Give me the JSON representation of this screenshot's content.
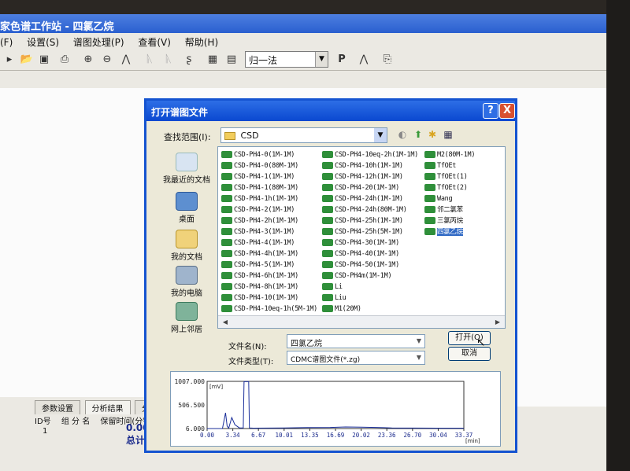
{
  "window": {
    "title": "家色谱工作站 - 四氯乙烷"
  },
  "menu": [
    {
      "label": "(F)"
    },
    {
      "label": "设置(S)"
    },
    {
      "label": "谱图处理(P)"
    },
    {
      "label": "查看(V)"
    },
    {
      "label": "帮助(H)"
    }
  ],
  "toolbar": {
    "icons": [
      "open-icon",
      "save-icon",
      "print-icon",
      "zoom-in-icon",
      "zoom-out-icon",
      "peak-icon",
      "integrate-icon",
      "report-icon",
      "table-icon"
    ],
    "method_combo": "归一法",
    "p_label": "P"
  },
  "bottom": {
    "tabs": [
      "参数设置",
      "分析结果",
      "分"
    ],
    "headers": [
      "ID号",
      "组 分 名",
      "保留时间(分钟)"
    ],
    "row_id": "1",
    "value": "0.000",
    "total_label": "总计:"
  },
  "dialog": {
    "title": "打开谱图文件",
    "help_btn": "?",
    "close_btn": "X",
    "look_in_label": "查找范围(I):",
    "look_in_value": "CSD",
    "places": [
      {
        "label": "我最近的文档",
        "icon": "recent-docs-icon"
      },
      {
        "label": "桌面",
        "icon": "desktop-icon"
      },
      {
        "label": "我的文档",
        "icon": "my-documents-icon"
      },
      {
        "label": "我的电脑",
        "icon": "my-computer-icon"
      },
      {
        "label": "网上邻居",
        "icon": "network-icon"
      }
    ],
    "files_col1": [
      "CSD-PH4-0(1M-1M)",
      "CSD-PH4-0(80M-1M)",
      "CSD-PH4-1(1M-1M)",
      "CSD-PH4-1(80M-1M)",
      "CSD-PH4-1h(1M-1M)",
      "CSD-PH4-2(1M-1M)",
      "CSD-PH4-2h(1M-1M)",
      "CSD-PH4-3(1M-1M)",
      "CSD-PH4-4(1M-1M)",
      "CSD-PH4-4h(1M-1M)",
      "CSD-PH4-5(1M-1M)",
      "CSD-PH4-6h(1M-1M)",
      "CSD-PH4-8h(1M-1M)",
      "CSD-PH4-10(1M-1M)",
      "CSD-PH4-10eq-1h(5M-1M)"
    ],
    "files_col2": [
      "CSD-PH4-10eq-2h(1M-1M)",
      "CSD-PH4-10h(1M-1M)",
      "CSD-PH4-12h(1M-1M)",
      "CSD-PH4-20(1M-1M)",
      "CSD-PH4-24h(1M-1M)",
      "CSD-PH4-24h(80M-1M)",
      "CSD-PH4-25h(1M-1M)",
      "CSD-PH4-25h(5M-1M)",
      "CSD-PH4-30(1M-1M)",
      "CSD-PH4-40(1M-1M)",
      "CSD-PH4-50(1M-1M)",
      "CSD-PH4m(1M-1M)",
      "Li",
      "Liu",
      "M1(20M)"
    ],
    "files_col3": [
      "M2(80M-1M)",
      "TfOEt",
      "TfOEt(1)",
      "TfOEt(2)",
      "Wang",
      "邻二氯苯",
      "三氯丙烷",
      "四氯乙烷"
    ],
    "selected_file": "四氯乙烷",
    "filename_label": "文件名(N):",
    "filename_value": "四氯乙烷",
    "filetype_label": "文件类型(T):",
    "filetype_value": "CDMC谱图文件(*.zg)",
    "open_btn": "打开(O)",
    "cancel_btn": "取消"
  },
  "chart_data": {
    "type": "line",
    "title": "",
    "ylabel": "[mV]",
    "xlabel": "[min]",
    "y_ticks": [
      "1007.000",
      "506.500",
      "6.000"
    ],
    "x_ticks": [
      "0.00",
      "3.34",
      "6.67",
      "10.01",
      "13.35",
      "16.69",
      "20.02",
      "23.36",
      "26.70",
      "30.04",
      "33.37"
    ],
    "xlim": [
      0,
      33.37
    ],
    "ylim": [
      6,
      1007
    ],
    "series": [
      {
        "x": [
          0,
          1.5,
          2.0,
          2.4,
          2.6,
          2.8,
          3.2,
          3.6,
          4.2,
          4.7,
          4.8,
          5.4,
          5.5,
          6.0,
          8.0,
          10.0,
          13.0,
          16.0,
          18.0,
          20.0,
          22.0,
          23.0,
          24.0,
          27.0,
          30.0,
          33.37
        ],
        "y": [
          6,
          6,
          8,
          340,
          60,
          12,
          240,
          90,
          20,
          18,
          1000,
          1000,
          20,
          15,
          16,
          20,
          26,
          30,
          40,
          36,
          30,
          24,
          18,
          16,
          14,
          14
        ]
      }
    ]
  }
}
